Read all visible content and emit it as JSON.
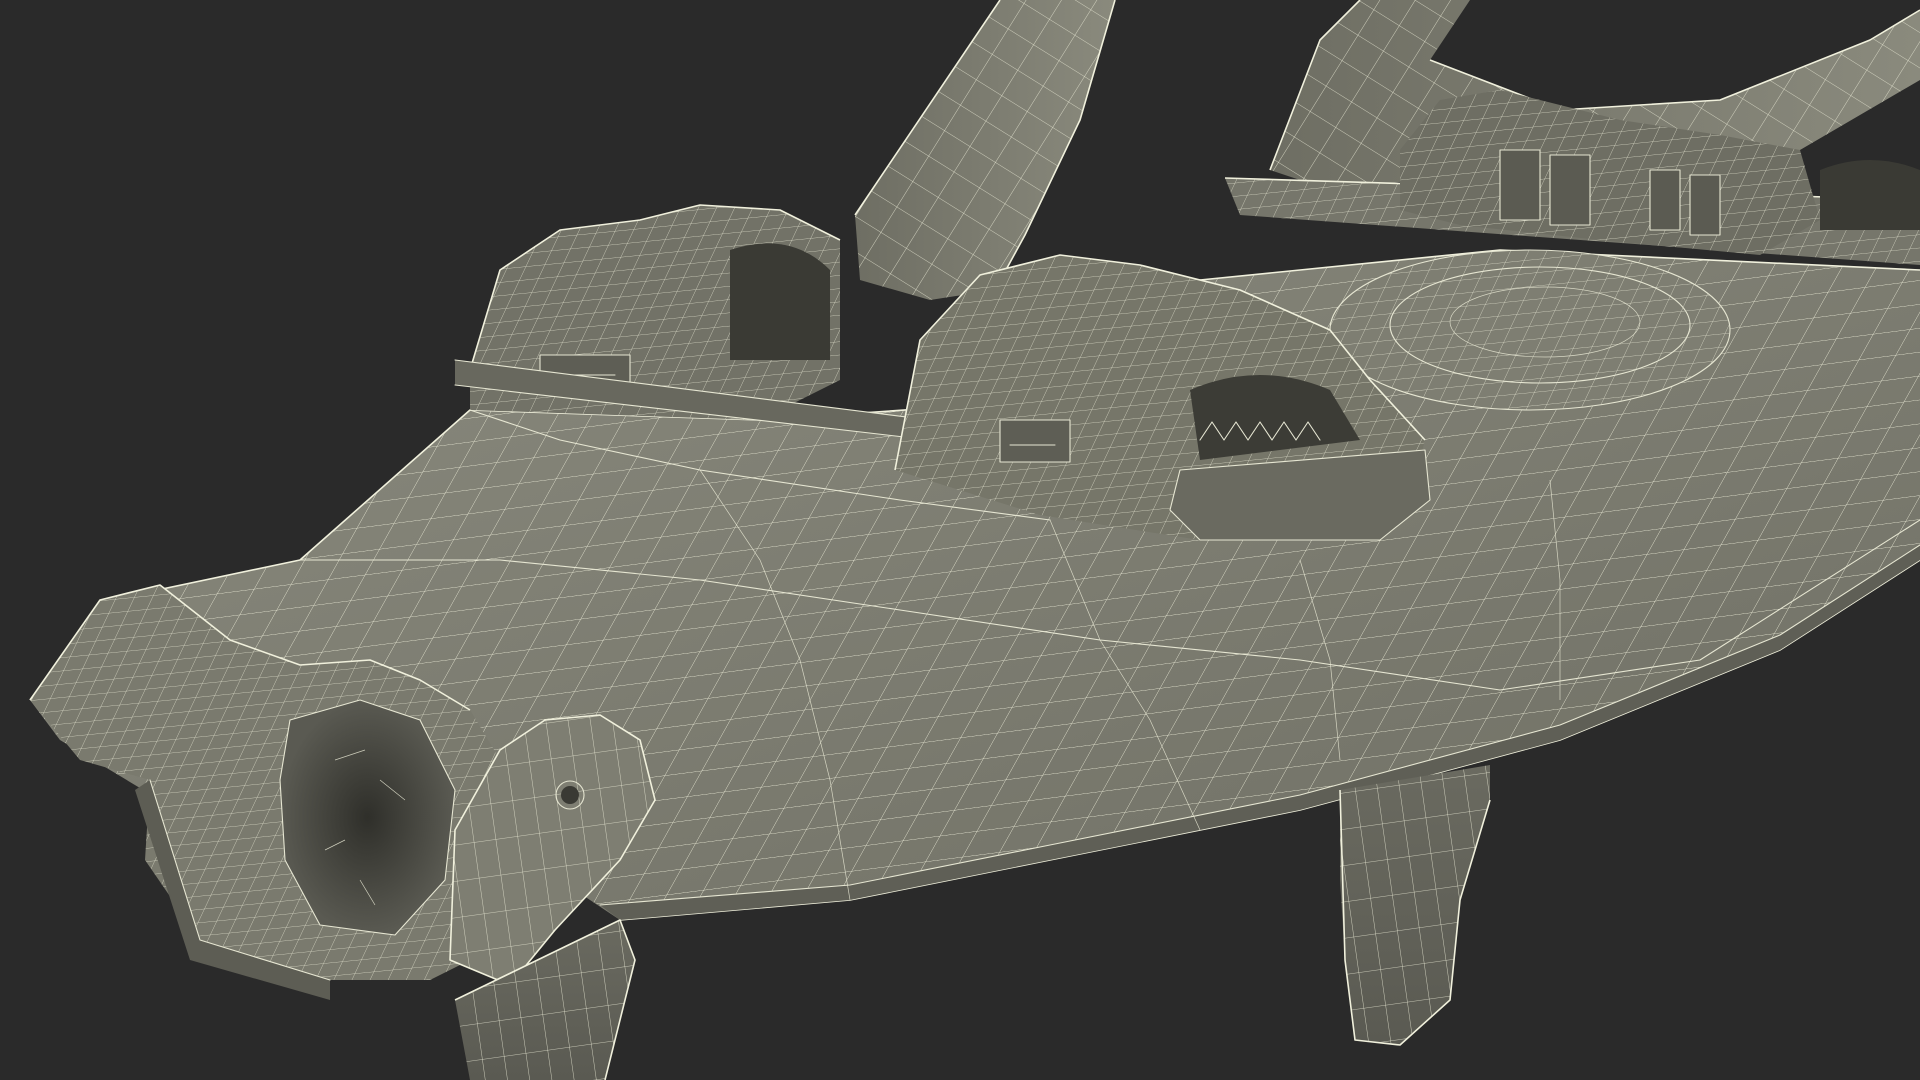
{
  "scene": {
    "subject": "wireframe-3d-model",
    "colors": {
      "background": "#2a2a2a",
      "surface": "#7a7a6e",
      "surface_light": "#8a8a7d",
      "surface_dark": "#55554c",
      "shadow": "#3a3a34",
      "wire": "#e6e6d2"
    }
  }
}
